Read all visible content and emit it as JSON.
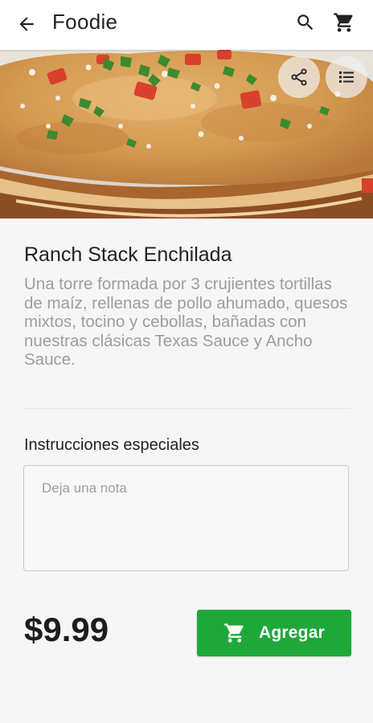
{
  "app": {
    "title": "Foodie"
  },
  "icons": {
    "back": "arrow-back-icon",
    "search": "search-icon",
    "cart": "cart-icon",
    "share": "share-icon",
    "list": "list-icon"
  },
  "product": {
    "name": "Ranch Stack Enchilada",
    "description": "Una torre formada por 3 crujientes tortillas de maíz, rellenas de pollo ahumado, quesos mixtos, tocino y cebollas, bañadas con nuestras clásicas Texas Sauce y Ancho Sauce.",
    "price": "$9.99"
  },
  "instructions": {
    "label": "Instrucciones especiales",
    "placeholder": "Deja una nota",
    "value": ""
  },
  "actions": {
    "add_label": "Agregar"
  },
  "colors": {
    "accent": "#1fa83a",
    "appbar": "#ffffff",
    "background": "#f6f6f6"
  }
}
